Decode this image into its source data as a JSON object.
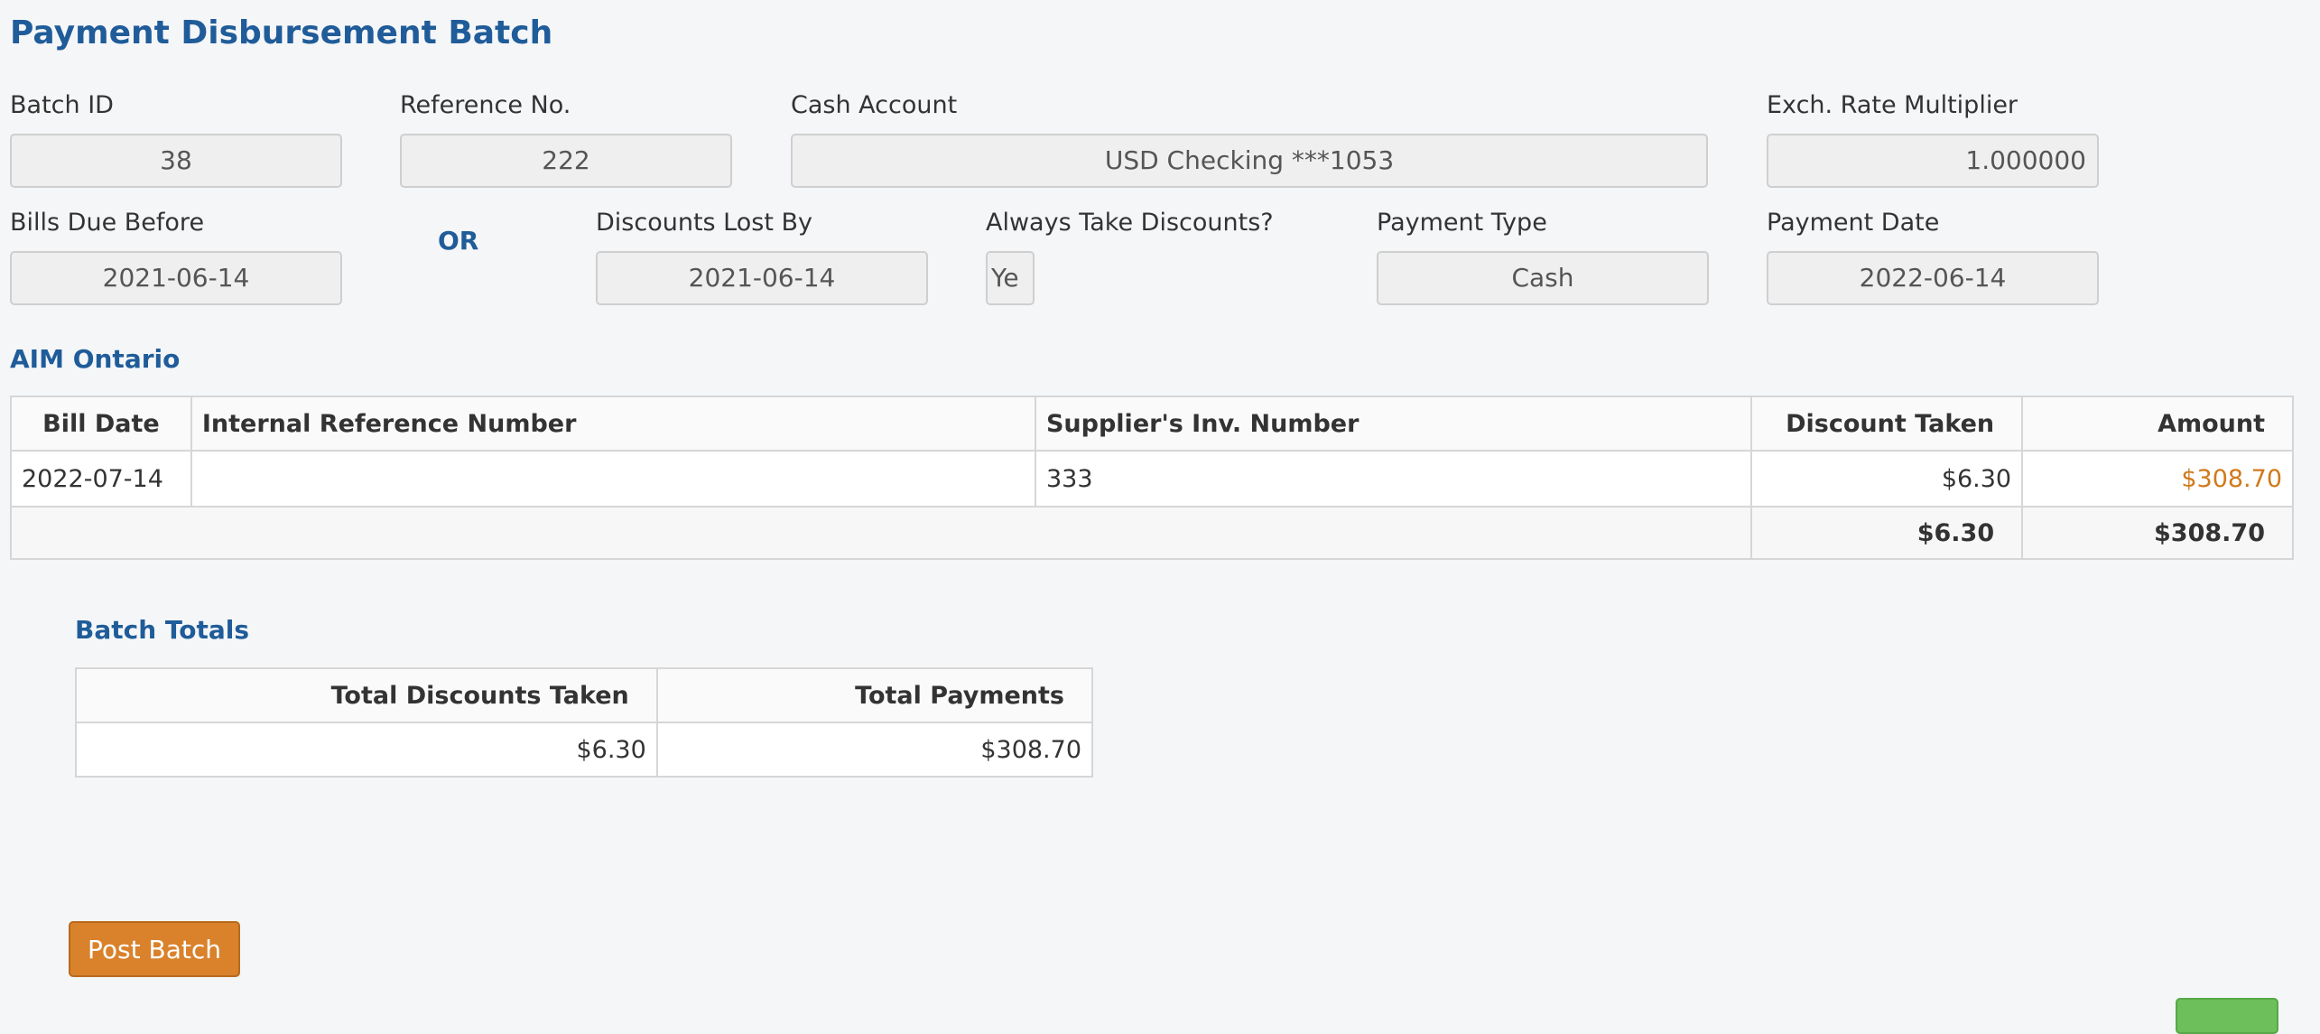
{
  "page": {
    "title": "Payment Disbursement Batch"
  },
  "fields": {
    "batch_id": {
      "label": "Batch ID",
      "value": "38"
    },
    "reference_no": {
      "label": "Reference No.",
      "value": "222"
    },
    "cash_account": {
      "label": "Cash Account",
      "value": "USD Checking ***1053"
    },
    "exch_rate": {
      "label": "Exch. Rate Multiplier",
      "value": "1.000000"
    },
    "bills_due_before": {
      "label": "Bills Due Before",
      "value": "2021-06-14"
    },
    "or_text": "OR",
    "discounts_lost_by": {
      "label": "Discounts Lost By",
      "value": "2021-06-14"
    },
    "always_take_discounts": {
      "label": "Always Take Discounts?",
      "value": "Ye"
    },
    "payment_type": {
      "label": "Payment Type",
      "value": "Cash"
    },
    "payment_date": {
      "label": "Payment Date",
      "value": "2022-06-14"
    }
  },
  "supplier": {
    "name": "AIM Ontario",
    "columns": [
      "Bill Date",
      "Internal Reference Number",
      "Supplier's Inv. Number",
      "Discount Taken",
      "Amount"
    ],
    "rows": [
      {
        "bill_date": "2022-07-14",
        "internal_ref": "",
        "supplier_inv": "333",
        "discount_taken": "$6.30",
        "amount": "$308.70"
      }
    ],
    "totals": {
      "discount_taken": "$6.30",
      "amount": "$308.70"
    }
  },
  "batch_totals": {
    "title": "Batch Totals",
    "columns": [
      "Total Discounts Taken",
      "Total Payments"
    ],
    "values": {
      "total_discounts": "$6.30",
      "total_payments": "$308.70"
    }
  },
  "actions": {
    "post_batch": "Post Batch"
  },
  "colors": {
    "title_blue": "#1f5c99",
    "accent_orange": "#d9822b",
    "link_orange": "#d07a1a",
    "success_green": "#6cbf5a"
  }
}
